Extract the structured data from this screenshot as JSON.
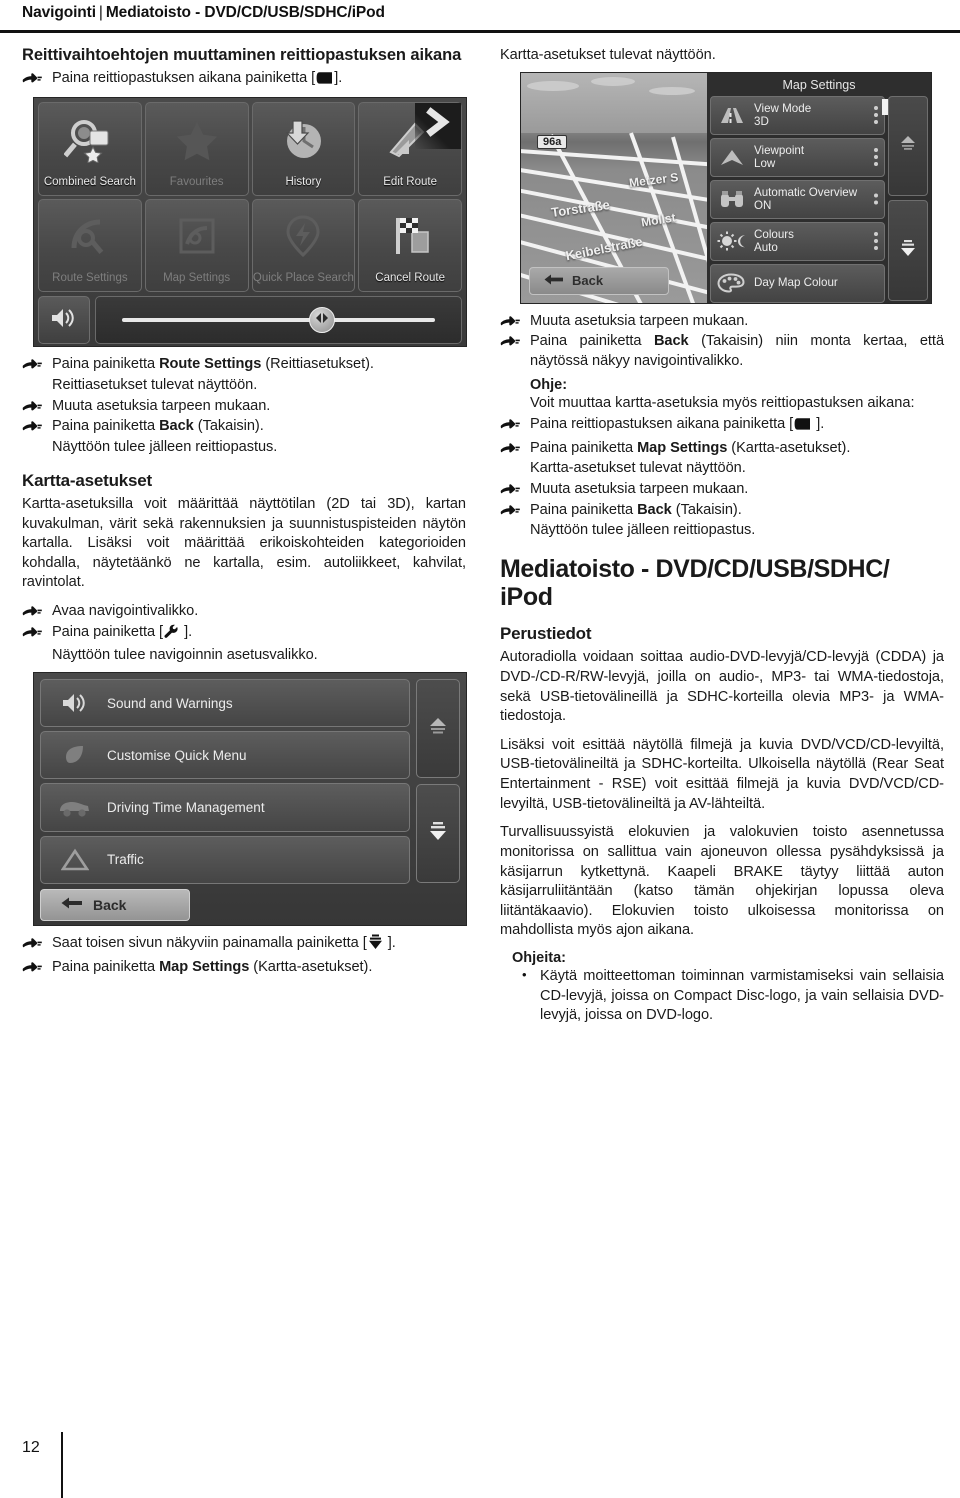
{
  "header": {
    "section": "Navigointi",
    "separator": "|",
    "chapter": "Mediatoisto - DVD/CD/USB/SDHC/iPod"
  },
  "page_number": "12",
  "left_column": {
    "heading": "Reittivaihtoehtojen muuttaminen reittiopastuksen aikana",
    "step_press_button_during_guidance": "Paina reittiopastuksen aikana painiketta [",
    "step_suffix": "].",
    "nav_screenshot": {
      "name": "navigation-quick-menu",
      "cells": [
        {
          "label": "Combined Search",
          "icon": "magnifier-star-icon",
          "dimmed": false
        },
        {
          "label": "Favourites",
          "icon": "star-icon",
          "dimmed": true
        },
        {
          "label": "History",
          "icon": "clock-download-icon",
          "dimmed": false
        },
        {
          "label": "Edit Route",
          "icon": "route-edit-icon",
          "dimmed": false
        },
        {
          "label": "Route Settings",
          "icon": "wrench-route-icon",
          "dimmed": true
        },
        {
          "label": "Map Settings",
          "icon": "map-wrench-icon",
          "dimmed": true
        },
        {
          "label": "Quick Place Search",
          "icon": "pin-flash-icon",
          "dimmed": true
        },
        {
          "label": "Cancel Route",
          "icon": "checkered-flag-icon",
          "dimmed": false
        }
      ],
      "volume_icon": "speaker-icon",
      "slider_knob_icon": "left-right-arrows-icon"
    },
    "steps_1": [
      {
        "type": "step",
        "pre": "Paina painiketta ",
        "bold": "Route Settings",
        "post": " (Reittiasetukset)."
      },
      {
        "type": "cont",
        "text": "Reittiasetukset tulevat näyttöön."
      },
      {
        "type": "step",
        "pre": "Muuta asetuksia tarpeen mukaan.",
        "bold": "",
        "post": ""
      },
      {
        "type": "step",
        "pre": "Paina painiketta ",
        "bold": "Back",
        "post": " (Takaisin)."
      },
      {
        "type": "cont",
        "text": "Näyttöön tulee jälleen reittiopastus."
      }
    ],
    "map_settings_heading": "Kartta-asetukset",
    "map_settings_body": "Kartta-asetuksilla voit määrittää näyttötilan (2D tai 3D), kartan kuvakulman, värit sekä rakennuksien ja suunnistuspisteiden näytön kartalla. Lisäksi voit määrittää erikoiskohteiden kategorioiden kohdalla, näytetäänkö ne kartalla, esim. autoliikkeet, kahvilat, ravintolat.",
    "steps_2": [
      {
        "type": "step",
        "text": "Avaa navigointivalikko."
      },
      {
        "type": "step_key",
        "pre": "Paina painiketta [",
        "key": "wrench-icon",
        "post": " ]."
      },
      {
        "type": "cont",
        "text": "Näyttöön tulee navigoinnin asetusvalikko."
      }
    ],
    "settings_screenshot": {
      "name": "navigation-settings-menu",
      "rows": [
        {
          "label": "Sound and Warnings",
          "icon": "speaker-icon"
        },
        {
          "label": "Customise Quick Menu",
          "icon": "leaf-icon"
        },
        {
          "label": "Driving Time Management",
          "icon": "truck-icon"
        },
        {
          "label": "Traffic",
          "icon": "warning-triangle-icon"
        }
      ],
      "back_label": "Back",
      "back_icon": "back-arrow-icon"
    },
    "steps_3": [
      {
        "type": "step_key",
        "pre": "Saat toisen sivun näkyviin painamalla painiketta  [",
        "key": "page-down-icon",
        "post": " ]."
      },
      {
        "type": "step_bold",
        "pre": "Paina painiketta ",
        "bold": "Map Settings",
        "post": " (Kartta-asetukset)."
      }
    ]
  },
  "right_column": {
    "intro_line": "Kartta-asetukset tulevat näyttöön.",
    "map_screenshot": {
      "name": "map-settings-screen",
      "title": "Map Settings",
      "map_labels": {
        "shield": "96a",
        "streets": [
          "Metzer S",
          "Torstraße",
          "Mollst",
          "Keibelstraße"
        ]
      },
      "back_label": "Back",
      "back_icon": "back-arrow-icon",
      "rows": [
        {
          "label": "View Mode",
          "value": "3D",
          "icon": "road-3d-icon",
          "dots": 3
        },
        {
          "label": "Viewpoint",
          "value": "Low",
          "icon": "viewpoint-arrow-icon",
          "dots": 3
        },
        {
          "label": "Automatic Overview",
          "value": "ON",
          "icon": "binoculars-icon",
          "dots": 2
        },
        {
          "label": "Colours",
          "value": "Auto",
          "icon": "sun-moon-icon",
          "dots": 3
        },
        {
          "label": "Day Map Colour",
          "value": "",
          "icon": "palette-icon",
          "dots": 0
        }
      ],
      "scroll_up_icon": "scroll-up-icon",
      "scroll_down_icon": "scroll-down-icon"
    },
    "steps_1": [
      {
        "type": "step",
        "text": "Muuta asetuksia tarpeen mukaan."
      },
      {
        "type": "step_bold_just",
        "pre": "Paina painiketta ",
        "bold": "Back",
        "post": " (Takaisin) niin monta kertaa, että näytössä näkyy navigointivalikko."
      }
    ],
    "tip_label": "Ohje:",
    "tip_text": "Voit muuttaa kartta-asetuksia myös reittiopastuksen aikana:",
    "steps_2": [
      {
        "type": "step_key",
        "pre": "Paina reittiopastuksen aikana painiketta [",
        "key": "map-key-icon",
        "post": " ]."
      },
      {
        "type": "step_bold",
        "pre": "Paina painiketta ",
        "bold": "Map Settings",
        "post": " (Kartta-asetukset)."
      },
      {
        "type": "cont",
        "text": "Kartta-asetukset tulevat näyttöön."
      },
      {
        "type": "step",
        "text": "Muuta asetuksia tarpeen mukaan."
      },
      {
        "type": "step_bold",
        "pre": "Paina painiketta ",
        "bold": "Back",
        "post": " (Takaisin)."
      },
      {
        "type": "cont",
        "text": "Näyttöön tulee jälleen reittiopastus."
      }
    ],
    "chapter_title": "Mediatoisto - DVD/CD/USB/SDHC/ iPod",
    "basics_heading": "Perustiedot",
    "paragraphs": [
      "Autoradiolla voidaan soittaa audio-DVD-levyjä/CD-levyjä (CDDA) ja DVD-/CD-R/RW-levyjä, joilla on audio-, MP3- tai WMA-tiedostoja, sekä USB-tietovälineillä ja SDHC-korteilla olevia MP3- ja WMA-tiedostoja.",
      "Lisäksi voit esittää näytöllä filmejä ja kuvia DVD/VCD/CD-levyiltä, USB-tietovälineiltä ja SDHC-korteilta. Ulkoisella näytöllä (Rear Seat Entertainment - RSE) voit esittää filmejä ja kuvia DVD/VCD/CD-levyiltä, USB-tietovälineiltä ja AV-lähteiltä.",
      "Turvallisuussyistä elokuvien ja valokuvien toisto asennetussa monitorissa on sallittua vain ajoneuvon ollessa pysähdyksissä ja käsijarrun kytkettynä. Kaapeli BRAKE täytyy liittää auton käsijarruliitäntään (katso tämän ohjekirjan lopussa oleva liitäntäkaavio). Elokuvien toisto ulkoisessa monitorissa on mahdollista myös ajon aikana."
    ],
    "tips_label": "Ohjeita:",
    "tips": [
      "Käytä moitteettoman toiminnan varmistamiseksi vain sellaisia CD-levyjä, joissa on Compact Disc-logo, ja vain sellaisia DVD-levyjä, joissa on DVD-logo."
    ]
  },
  "colors": {
    "ink": "#111111",
    "screen_bg": "#3c3c3c",
    "screen_text": "#ececec"
  }
}
